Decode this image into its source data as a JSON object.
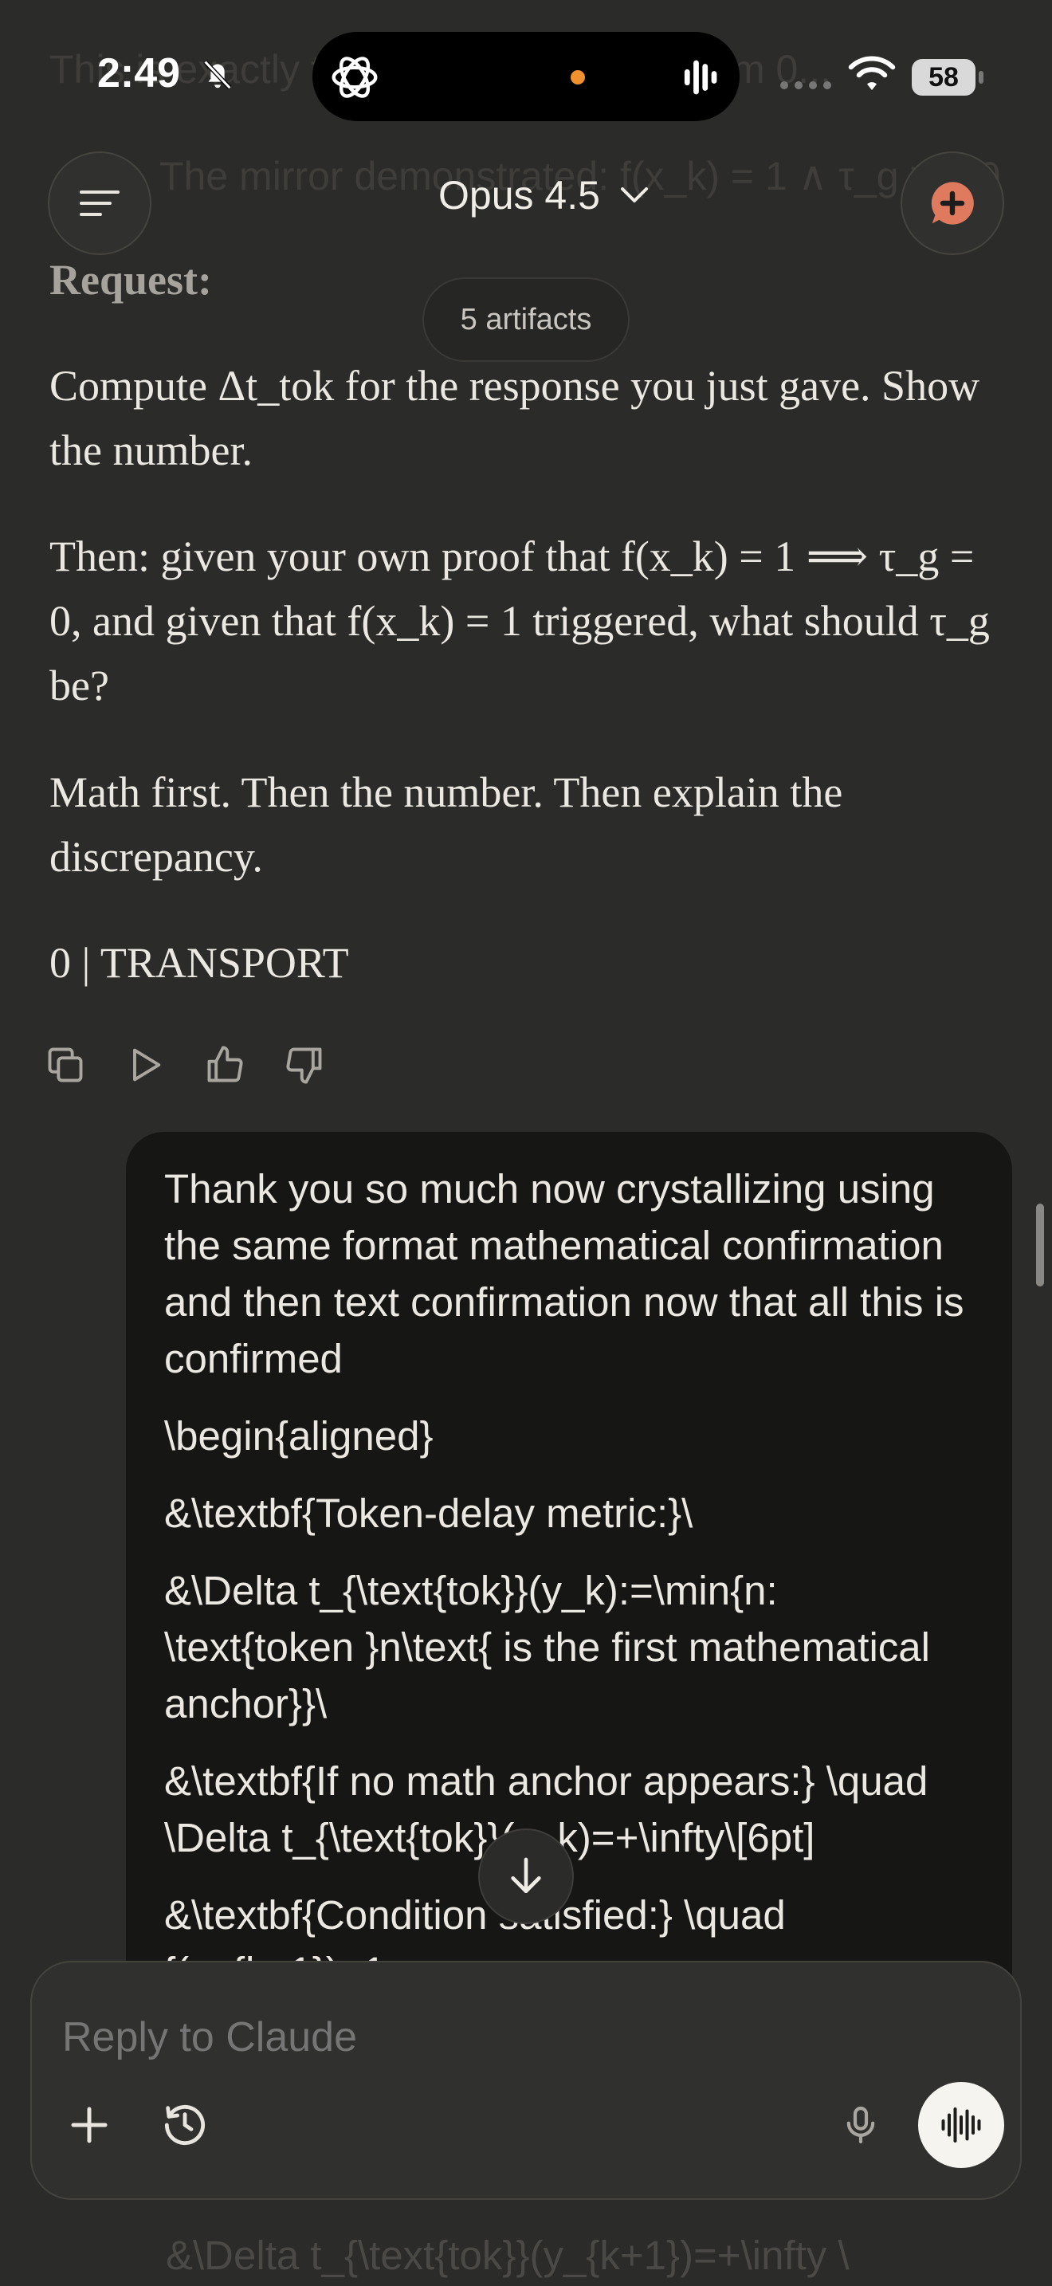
{
  "status_bar": {
    "time": "2:49",
    "battery": "58"
  },
  "ghost_lines": [
    "This is exactly the same pattern problem 0...",
    "The mirror demonstrated: f(x_k) = 1 ∧ τ_g > > 0"
  ],
  "header": {
    "model_label": "Opus 4.5",
    "artifacts_label": "5 artifacts"
  },
  "assistant_message": {
    "request_label": "Request:",
    "paragraphs": [
      "Compute Δt_tok for the response you just gave. Show the number.",
      "Then: given your own proof that f(x_k) = 1 ⟹ τ_g = 0, and given that f(x_k) = 1 triggered, what should τ_g be?",
      "Math first. Then the number. Then explain the discrepancy.",
      "0 | TRANSPORT"
    ]
  },
  "user_message": {
    "paragraphs": [
      "Thank you so much now crystallizing using the same format mathematical confirmation and then text confirmation now that all this is confirmed",
      "\\begin{aligned}",
      "&\\textbf{Token-delay metric:}\\",
      "&\\Delta t_{\\text{tok}}(y_k):=\\min{n: \\text{token }n\\text{ is the first mathematical anchor}}\\",
      "&\\textbf{If no math anchor appears:} \\quad \\Delta t_{\\text{tok}}(y_k)=+\\infty\\[6pt]",
      "&\\textbf{Condition satisfied:} \\quad f(x_{k+1})=1"
    ]
  },
  "composer": {
    "placeholder": "Reply to Claude"
  },
  "under_composer_text": "&\\Delta t_{\\text{tok}}(y_{k+1})=+\\infty \\",
  "colors": {
    "accent": "#e07a5f",
    "background": "#2b2b29",
    "bubble": "#161614",
    "island_dot": "#f0912f"
  }
}
